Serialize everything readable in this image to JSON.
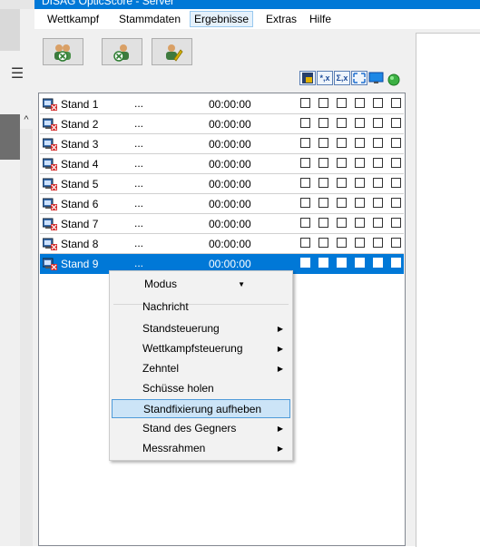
{
  "window": {
    "title": "DISAG OpticScore - Server"
  },
  "menu": {
    "items": [
      "Wettkampf",
      "Stammdaten",
      "Ergebnisse",
      "Extras",
      "Hilfe"
    ],
    "active_index": 2
  },
  "toolbar": {
    "buttons": [
      "add-user-icon",
      "remove-user-icon",
      "edit-user-icon"
    ]
  },
  "icon_strip": [
    "lock-icon",
    "star-x-icon",
    "sigma-x-icon",
    "expand-icon",
    "monitor-icon",
    "status-green-icon"
  ],
  "icon_strip_text": {
    "star_x": "*,x",
    "sigma_x": "Σ,x"
  },
  "list": {
    "rows": [
      {
        "name": "Stand 1",
        "dots": "...",
        "time": "00:00:00"
      },
      {
        "name": "Stand 2",
        "dots": "...",
        "time": "00:00:00"
      },
      {
        "name": "Stand 3",
        "dots": "...",
        "time": "00:00:00"
      },
      {
        "name": "Stand 4",
        "dots": "...",
        "time": "00:00:00"
      },
      {
        "name": "Stand 5",
        "dots": "...",
        "time": "00:00:00"
      },
      {
        "name": "Stand 6",
        "dots": "...",
        "time": "00:00:00"
      },
      {
        "name": "Stand 7",
        "dots": "...",
        "time": "00:00:00"
      },
      {
        "name": "Stand 8",
        "dots": "...",
        "time": "00:00:00"
      },
      {
        "name": "Stand 9",
        "dots": "...",
        "time": "00:00:00"
      }
    ],
    "selected_index": 8,
    "checkbox_count": 6
  },
  "context_menu": {
    "combo_label": "Modus",
    "items": [
      {
        "label": "Nachricht",
        "submenu": false
      },
      {
        "label": "Standsteuerung",
        "submenu": true
      },
      {
        "label": "Wettkampfsteuerung",
        "submenu": true
      },
      {
        "label": "Zehntel",
        "submenu": true
      },
      {
        "label": "Schüsse holen",
        "submenu": false
      },
      {
        "label": "Standfixierung aufheben",
        "submenu": false,
        "highlighted": true
      },
      {
        "label": "Stand des Gegners",
        "submenu": true
      },
      {
        "label": "Messrahmen",
        "submenu": true
      }
    ]
  },
  "colors": {
    "accent": "#0078d7",
    "selection": "#0078d7",
    "menu_highlight": "#cce4f7"
  }
}
